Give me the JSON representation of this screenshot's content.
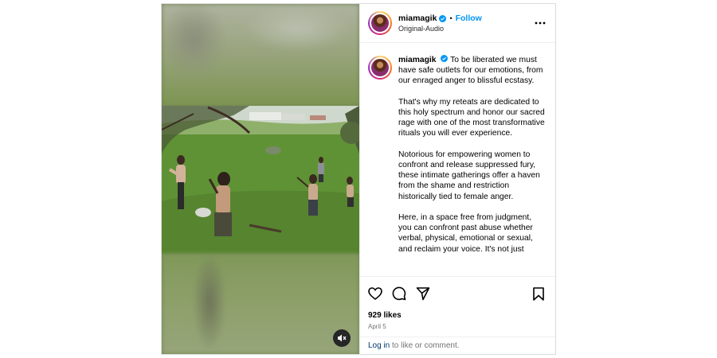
{
  "post": {
    "username": "miamagik",
    "follow_label": "Follow",
    "dot": "•",
    "audio_label": "Original-Audio",
    "more_icon": "more-horizontal-icon",
    "verified_color": "#0095f6"
  },
  "caption": {
    "username": "miamagik",
    "paragraphs": [
      "To be liberated we must have safe outlets for our emotions, from our enraged anger to blissful ecstasy.",
      "That's why my reteats are dedicated to this holy spectrum and honor our sacred rage with one of the most transformative rituals you will ever experience.",
      "Notorious for empowering women to confront and release suppressed fury, these intimate gatherings offer a haven from the shame and restriction historically tied to female anger.",
      "Here, in a space free from judgment, you can confront past abuse whether verbal, physical, emotional or sexual, and reclaim your voice. It's not just"
    ]
  },
  "actions": {
    "icons": [
      "heart-icon",
      "comment-icon",
      "share-icon",
      "bookmark-icon"
    ],
    "likes": "929 likes",
    "date": "April 5"
  },
  "login": {
    "link_text": "Log in",
    "rest_text": " to like or comment."
  },
  "media": {
    "mute_icon": "speaker-muted-icon"
  }
}
